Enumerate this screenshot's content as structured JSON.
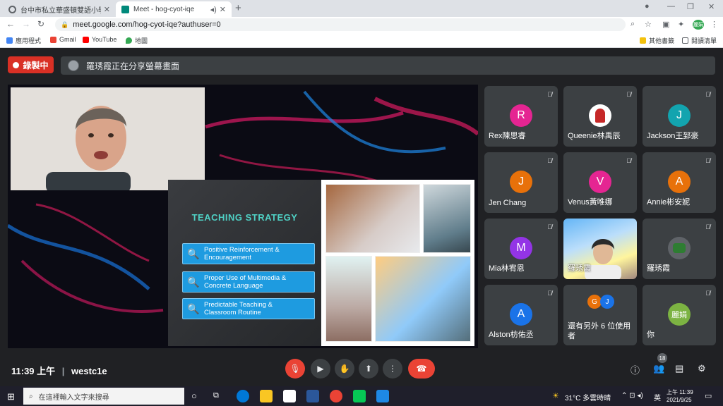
{
  "browser": {
    "tabs": [
      {
        "title": "台中市私立華盛頓雙語小學",
        "active": false,
        "favicon_color": "#5f6368"
      },
      {
        "title": "Meet - hog-cyot-iqe",
        "active": true,
        "favicon_color": "#00897b"
      }
    ],
    "url": "meet.google.com/hog-cyot-iqe?authuser=0",
    "profile_label": "麗娟",
    "bookmarks": [
      {
        "label": "應用程式",
        "color": "#4285f4"
      },
      {
        "label": "Gmail",
        "color": "#ea4335"
      },
      {
        "label": "YouTube",
        "color": "#ff0000"
      },
      {
        "label": "地圖",
        "color": "#34a853"
      }
    ],
    "other_bookmarks": "其他書籤",
    "reading_list": "閱讀清單"
  },
  "meet": {
    "recording_label": "錄製中",
    "presenting_text": "羅琇霞正在分享螢幕畫面",
    "presentation": {
      "title": "TEACHING STRATEGY",
      "strategies": [
        {
          "line1": "Positive Reinforcement &",
          "line2": "Encouragement"
        },
        {
          "line1": "Proper Use of Multimedia &",
          "line2": "Concrete Language"
        },
        {
          "line1": "Predictable Teaching &",
          "line2": "Classroom Routine"
        }
      ]
    },
    "participants": [
      {
        "name": "Rex陳思睿",
        "initial": "R",
        "color": "#e52592"
      },
      {
        "name": "Queenie林禹辰",
        "initial": "",
        "color": "#ffffff"
      },
      {
        "name": "Jackson王郅豪",
        "initial": "J",
        "color": "#12a4af"
      },
      {
        "name": "Jen Chang",
        "initial": "J",
        "color": "#e8710a"
      },
      {
        "name": "Venus黃唯娜",
        "initial": "V",
        "color": "#e52592"
      },
      {
        "name": "Annie彬安妮",
        "initial": "A",
        "color": "#e8710a"
      },
      {
        "name": "Mia林宥恩",
        "initial": "M",
        "color": "#9334e6"
      },
      {
        "name": "羅琇霞",
        "initial": "",
        "color": ""
      },
      {
        "name": "羅琇霞",
        "initial": "",
        "color": "#5f6368"
      },
      {
        "name": "Alston枋佑丞",
        "initial": "A",
        "color": "#1a73e8"
      },
      {
        "name": "還有另外 6 位使用者",
        "initial": "",
        "color": ""
      },
      {
        "name": "你",
        "initial": "麗娟",
        "color": "#7cb342"
      }
    ],
    "more_avatars": [
      {
        "initial": "G",
        "color": "#e8710a"
      },
      {
        "initial": "J",
        "color": "#1a73e8"
      }
    ],
    "time": "11:39 上午",
    "meeting_code": "westc1e",
    "participant_count": "18"
  },
  "taskbar": {
    "search_placeholder": "在這裡輸入文字來搜尋",
    "weather": "31°C 多雲時晴",
    "ime": "英",
    "clock_time": "上午 11:39",
    "clock_date": "2021/9/25"
  }
}
